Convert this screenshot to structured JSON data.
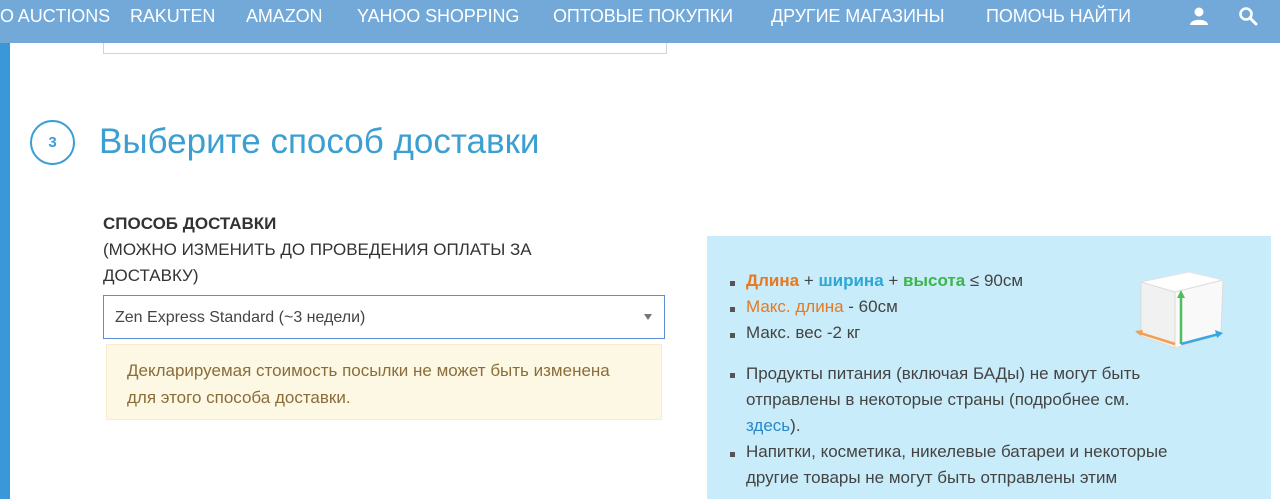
{
  "nav": {
    "items": [
      {
        "id": "auctions",
        "label": "O AUCTIONS"
      },
      {
        "id": "rakuten",
        "label": "RAKUTEN"
      },
      {
        "id": "amazon",
        "label": "AMAZON"
      },
      {
        "id": "yahoo",
        "label": "YAHOO SHOPPING"
      },
      {
        "id": "wholesale",
        "label": "ОПТОВЫЕ ПОКУПКИ"
      },
      {
        "id": "other",
        "label": "ДРУГИЕ МАГАЗИНЫ"
      },
      {
        "id": "help",
        "label": "ПОМОЧЬ НАЙТИ"
      }
    ],
    "user_icon": "user-icon",
    "search_icon": "search-icon"
  },
  "step": {
    "number": "3",
    "title": "Выберите способ доставки"
  },
  "shipping": {
    "label_main": "СПОСОБ ДОСТАВКИ",
    "label_note": "(МОЖНО ИЗМЕНИТЬ ДО ПРОВЕДЕНИЯ ОПЛАТЫ ЗА ДОСТАВКУ)",
    "selected": "Zen Express Standard (~3 недели)",
    "notice": "Декларируемая стоимость посылки не может быть изменена для этого способа доставки."
  },
  "info": {
    "dims": {
      "length": "Длина",
      "plus1": " + ",
      "width": "ширина",
      "plus2": " + ",
      "height": "высота",
      "limit": " ≤ 90см"
    },
    "max_length_label": "Макс. длина",
    "max_length_value": " - 60см",
    "max_weight": "Макс. вес -2 кг",
    "food_text_1": "Продукты питания (включая БАДы) не могут быть",
    "food_text_2": "отправлены в некоторые страны (подробнее см.",
    "food_link": "здесь",
    "food_text_end": ").",
    "drinks_text_1": "Напитки, косметика, никелевые батареи и некоторые",
    "drinks_text_2": "другие товары не могут быть отправлены этим"
  },
  "colors": {
    "nav_bg": "#72a9d8",
    "accent": "#3c9fd2",
    "info_bg": "#c8ecfa",
    "orange": "#e8781e",
    "blue": "#2ca7d6",
    "green": "#3cb54a"
  }
}
